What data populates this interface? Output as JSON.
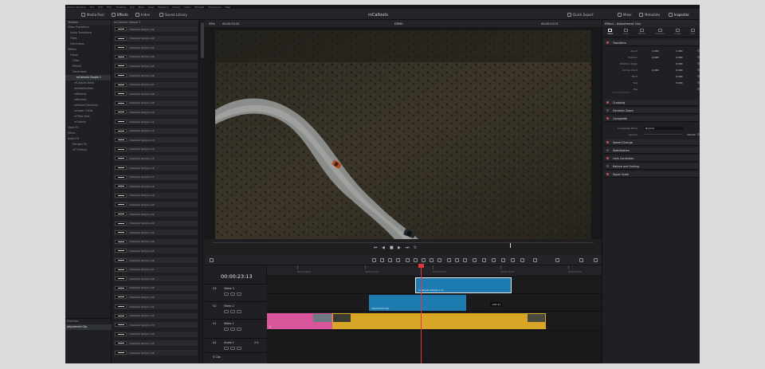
{
  "menu": [
    "DaVinci Resolve",
    "File",
    "Edit",
    "Trim",
    "Timeline",
    "Clip",
    "Mark",
    "View",
    "Playback",
    "Fusion",
    "Color",
    "Fairlight",
    "Workspace",
    "Help"
  ],
  "toolbar": {
    "media_pool": "Media Pool",
    "effects": "Effects",
    "index": "Index",
    "sound_library": "Sound Library",
    "quick_export": "Quick Export",
    "mixer": "Mixer",
    "metadata": "Metadata",
    "inspector": "Inspector"
  },
  "title": "mCallouts",
  "left_panel": {
    "head": "Toolbox",
    "tree": [
      "Video Transitions",
      "Audio Transitions",
      "Titles",
      "Generators",
      "Effects",
      "Fusion",
      "Titles",
      "Effects",
      "Generators",
      "mCallouts Simple 1",
      "mCallouts Basic",
      "mHeadlineSets",
      "mButtons",
      "mReveals",
      "mMotion Elements",
      "mLower Thirds",
      "mTitles Sets",
      "mTutorial",
      "Open FX",
      "Filters",
      "Audio FX",
      "Fairlight FX",
      "VST Effects"
    ],
    "selected": "mCallouts Simple 1",
    "favorites_head": "Favorites",
    "favorites": [
      "Adjustment Clip"
    ]
  },
  "effects_panel": {
    "head": "mCallouts Simple 1",
    "items": [
      "mCallouts Simple 1.01",
      "mCallouts Simple 1.02",
      "mCallouts Simple 1.03",
      "mCallouts Simple 1.04",
      "mCallouts Simple 1.05",
      "mCallouts Simple 1.06",
      "mCallouts Simple 1.07",
      "mCallouts Simple 1.08",
      "mCallouts Simple 1.09",
      "mCallouts Simple 1.10",
      "mCallouts Simple 1.11",
      "mCallouts Simple 1.12",
      "mCallouts Simple 1.13",
      "mCallouts Simple 1.14",
      "mCallouts Simple 1.15",
      "mCallouts Simple 1.16",
      "mCallouts Simple 1.17",
      "mCallouts Simple 1.18",
      "mCallouts Simple 1.19",
      "mCallouts Simple 1.20",
      "mCallouts Simple 1.21",
      "mCallouts Simple 1.22",
      "mCallouts Simple 1.23",
      "mCallouts Simple 1.24",
      "mCallouts Simple 1.25",
      "mCallouts Simple 1.26",
      "mCallouts Simple 1.27",
      "mCallouts Simple 1.28",
      "mCallouts Simple 1.29",
      "mCallouts Simple 1.30",
      "mCallouts Simple 1.31",
      "mCallouts Simple 1.32",
      "mCallouts Simple 1.33",
      "mCallouts Simple 1.34",
      "mCallouts Simple 1.35",
      "mCallouts Simple 1.36"
    ]
  },
  "viewer": {
    "zoom": "39%",
    "timecode_in": "00:00:33:20",
    "clip_name": "DEMO",
    "timecode_out": "00:00:23:13",
    "playhead_fraction": 0.78
  },
  "inspector": {
    "head": "Effect - Adjustment Clip",
    "tabs": [
      "Video",
      "Audio",
      "Effects",
      "Transition",
      "Image",
      "File"
    ],
    "active_tab": "Video",
    "transform": "Transform",
    "rows": [
      {
        "label": "Zoom",
        "x": "1.000",
        "y": "1.000"
      },
      {
        "label": "Position",
        "x": "0.000",
        "y": "0.000"
      },
      {
        "label": "Rotation Angle",
        "x": "",
        "y": "0.000"
      },
      {
        "label": "Anchor Point",
        "x": "0.000",
        "y": "0.000"
      },
      {
        "label": "Pitch",
        "x": "",
        "y": "0.000"
      },
      {
        "label": "Yaw",
        "x": "",
        "y": "0.000"
      },
      {
        "label": "Flip",
        "x": "",
        "y": ""
      }
    ],
    "smart_reframe": "Smart Reframe",
    "sections_a": [
      "Cropping",
      "Dynamic Zoom",
      "Composite"
    ],
    "composite_mode_label": "Composite Mode",
    "composite_mode": "Normal",
    "opacity_label": "Opacity",
    "opacity": "100.00",
    "sections_b": [
      "Speed Change",
      "Stabilization",
      "Lens Correction",
      "Retime and Scaling",
      "Super Scale"
    ]
  },
  "timeline": {
    "timecode": "00:00:23:13",
    "ruler": [
      "00:00:18:00",
      "00:00:20:00",
      "00:00:22:00",
      "00:00:24:00",
      "00:00:26:00"
    ],
    "tracks": [
      {
        "id": "V3",
        "name": "Video 3"
      },
      {
        "id": "V2",
        "name": "Video 2"
      },
      {
        "id": "V1",
        "name": "Video 1"
      },
      {
        "id": "A1",
        "name": "Audio 1",
        "gain": "2.0"
      },
      {
        "sub": "0 Clip"
      }
    ],
    "clips": {
      "v3": "mCallouts Simple 1.13",
      "v2": "Adjustment Clip",
      "v1_label": "Z"
    },
    "tooltip": "+00:11"
  },
  "colors": {
    "accent": "#e0383e",
    "clip_blue": "#1e7bb0",
    "clip_yellow": "#d9a526",
    "clip_pink": "#d8559b"
  }
}
